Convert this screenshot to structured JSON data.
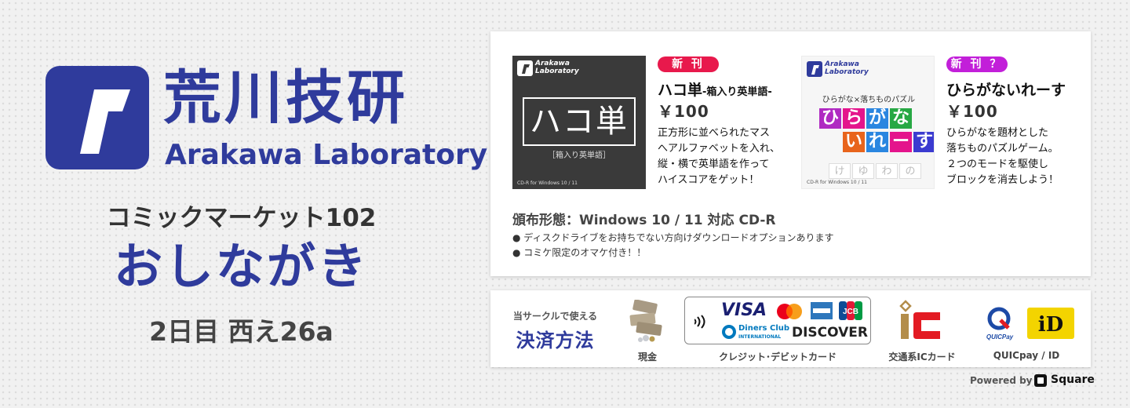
{
  "brand": {
    "name_jp": "荒川技研",
    "name_en": "Arakawa Laboratory",
    "color": "#2f3b9c"
  },
  "event": {
    "name": "コミックマーケット102",
    "title": "おしながき",
    "booth": "2日目  西え26a"
  },
  "products": [
    {
      "badge": "新 刊",
      "badge_color": "#e8194c",
      "title": "ハコ単",
      "subtitle": "-箱入り英単語-",
      "price": "￥100",
      "description": "正方形に並べられたマス\nへアルファベットを入れ、\n縦・横で英単語を作って\nハイスコアをゲット！",
      "cover": {
        "logo_text_1": "Arakawa",
        "logo_text_2": "Laboratory",
        "main_text": "ハコ単",
        "sub_text": "［箱入り英単語］",
        "media_label": "CD-R for Windows 10 / 11"
      }
    },
    {
      "badge": "新 刊 ？",
      "badge_color": "#c21fd9",
      "title": "ひらがないれーす",
      "subtitle": "",
      "price": "￥100",
      "description": "ひらがなを題材とした\n落ちものパズルゲーム。\n２つのモードを駆使し\nブロックを消去しよう！",
      "cover": {
        "logo_text_1": "Arakawa",
        "logo_text_2": "Laboratory",
        "caption": "ひらがな×落ちものパズル",
        "tiles_row1": [
          "ひ",
          "ら",
          "が",
          "な"
        ],
        "tiles_row2": [
          "い",
          "れ",
          "ー",
          "す"
        ],
        "media_label": "CD-R for Windows 10 / 11"
      }
    }
  ],
  "distribution": {
    "title": "頒布形態：Windows 10 / 11 対応 CD-R",
    "notes": [
      "● ディスクドライブをお持ちでない方向けダウンロードオプションあります",
      "● コミケ限定のオマケ付き！！"
    ]
  },
  "payment": {
    "caption": "当サークルで使える",
    "heading": "決済方法",
    "methods": [
      {
        "label": "現金",
        "icon": "cash-icon"
      },
      {
        "label": "クレジット･デビットカード",
        "icon": "credit-card-icons"
      },
      {
        "label": "交通系ICカード",
        "icon": "ic-card-icon"
      },
      {
        "label": "QUICpay / ID",
        "icon": "quicpay-id-icons"
      }
    ],
    "card_brands": {
      "visa": "VISA",
      "diners_1": "Diners Club",
      "diners_2": "INTERNATIONAL",
      "discover": "DISCOVER",
      "jcb": "JCB",
      "quicpay": "QUICPay",
      "id": "iD"
    },
    "powered_by": "Powered by",
    "provider": "Square"
  }
}
